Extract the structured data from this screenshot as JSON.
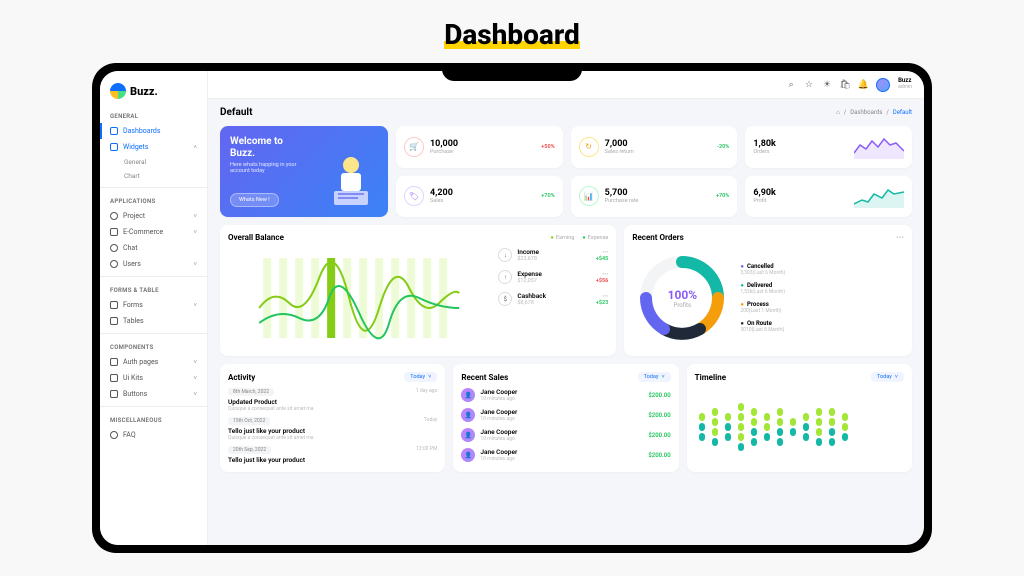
{
  "outer_title": "Dashboard",
  "brand": "Buzz.",
  "sidebar": {
    "sections": {
      "general": "GENERAL",
      "applications": "APPLICATIONS",
      "forms": "FORMS & TABLE",
      "components": "COMPONENTS",
      "misc": "MISCELLANEOUS"
    },
    "items": {
      "dashboards": "Dashboards",
      "widgets": "Widgets",
      "widgets_general": "General",
      "widgets_chart": "Chart",
      "project": "Project",
      "ecommerce": "E-Commerce",
      "chat": "Chat",
      "users": "Users",
      "forms": "Forms",
      "tables": "Tables",
      "authpages": "Auth pages",
      "uikits": "Ui Kits",
      "buttons": "Buttons",
      "faq": "FAQ"
    }
  },
  "user": {
    "name": "Buzz",
    "role": "admin"
  },
  "page": {
    "title": "Default",
    "crumb_dash": "Dashboards",
    "crumb_current": "Default"
  },
  "welcome": {
    "title1": "Welcome to",
    "title2": "Buzz.",
    "subtitle": "Here whats happing in your account today",
    "button": "Whats New !"
  },
  "stats": {
    "purchase": {
      "value": "10,000",
      "label": "Purchase",
      "change": "+50%"
    },
    "salesreturn": {
      "value": "7,000",
      "label": "Sales return",
      "change": "-20%"
    },
    "orders": {
      "value": "1,80k",
      "label": "Orders"
    },
    "sales": {
      "value": "4,200",
      "label": "Sales",
      "change": "+70%"
    },
    "purchaserate": {
      "value": "5,700",
      "label": "Purchase rate",
      "change": "+70%"
    },
    "profit": {
      "value": "6,90k",
      "label": "Profit"
    }
  },
  "balance": {
    "title": "Overall Balance",
    "legend_earning": "Earning",
    "legend_expense": "Expense",
    "items": {
      "income": {
        "title": "Income",
        "sub": "$22,678",
        "change": "+$45"
      },
      "expense": {
        "title": "Expense",
        "sub": "$12,057",
        "change": "+$56"
      },
      "cashback": {
        "title": "Cashback",
        "sub": "$8,678",
        "change": "+$23"
      }
    }
  },
  "orders": {
    "title": "Recent Orders",
    "center_pct": "100%",
    "center_label": "Profits",
    "legend": {
      "cancelled": {
        "name": "Cancelled",
        "sub": "3,303(Last 6 Month)"
      },
      "delivered": {
        "name": "Delivered",
        "sub": "1,53k(Last 6 Month)"
      },
      "process": {
        "name": "Process",
        "sub": "200(Last 1 Month)"
      },
      "onroute": {
        "name": "On Route",
        "sub": "3010(Last 8 Month)"
      }
    }
  },
  "activity": {
    "title": "Activity",
    "filter": "Today",
    "items": [
      {
        "date": "8th March, 2022",
        "time": "1 day ago",
        "title": "Updated Product",
        "desc": "Quisque a consequat ante sit amet ma"
      },
      {
        "date": "15th Oct, 2022",
        "time": "Today",
        "title": "Tello just like your product",
        "desc": "Quisque a consequat ante sit amet ma"
      },
      {
        "date": "20th Sep, 2022",
        "time": "12:00 PM",
        "title": "Tello just like your product",
        "desc": ""
      }
    ]
  },
  "sales": {
    "title": "Recent Sales",
    "filter": "Today",
    "items": [
      {
        "name": "Jane Cooper",
        "time": "10 minutes ago",
        "amount": "$200.00"
      },
      {
        "name": "Jane Cooper",
        "time": "10 minutes ago",
        "amount": "$200.00"
      },
      {
        "name": "Jane Cooper",
        "time": "10 minutes ago",
        "amount": "$200.00"
      },
      {
        "name": "Jane Cooper",
        "time": "10 minutes ago",
        "amount": "$200.00"
      }
    ]
  },
  "timeline": {
    "title": "Timeline",
    "filter": "Today"
  },
  "chart_data": {
    "stats": [
      {
        "label": "Purchase",
        "value": 10000,
        "change_pct": 50
      },
      {
        "label": "Sales return",
        "value": 7000,
        "change_pct": -20
      },
      {
        "label": "Orders",
        "value": 180000
      },
      {
        "label": "Sales",
        "value": 4200,
        "change_pct": 70
      },
      {
        "label": "Purchase rate",
        "value": 5700,
        "change_pct": 70
      },
      {
        "label": "Profit",
        "value": 690000
      }
    ],
    "overall_balance": {
      "type": "line",
      "series": [
        {
          "name": "Earning",
          "color": "#84cc16",
          "values": [
            40,
            55,
            35,
            70,
            50,
            80,
            45,
            60,
            30,
            55,
            75,
            50
          ]
        },
        {
          "name": "Expense",
          "color": "#22c55e",
          "values": [
            20,
            30,
            55,
            40,
            70,
            35,
            60,
            25,
            50,
            40,
            55,
            65
          ]
        }
      ],
      "income": 22678,
      "expense": 12057,
      "cashback": 8678,
      "income_delta": 45,
      "expense_delta": 56,
      "cashback_delta": 23
    },
    "recent_orders": {
      "type": "donut",
      "center": "100% Profits",
      "slices": [
        {
          "name": "Cancelled",
          "value": 3303,
          "color": "#6366f1"
        },
        {
          "name": "Delivered",
          "value": 153000,
          "color": "#14b8a6"
        },
        {
          "name": "Process",
          "value": 200,
          "color": "#f59e0b"
        },
        {
          "name": "On Route",
          "value": 3010,
          "color": "#1f2937"
        }
      ]
    },
    "timeline_bars": {
      "type": "bar",
      "segments_per_bar": "varies",
      "bars": [
        3,
        4,
        3,
        5,
        4,
        3,
        4,
        2,
        3,
        4,
        4,
        3
      ]
    }
  }
}
